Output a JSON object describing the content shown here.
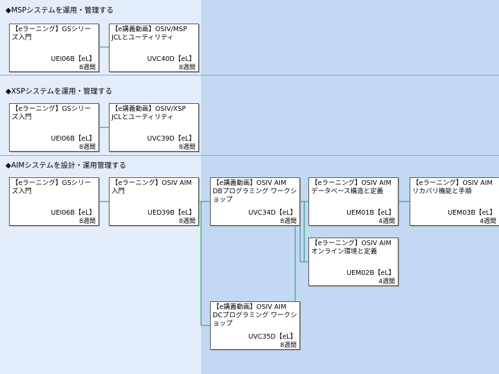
{
  "sections": [
    {
      "heading": "◆MSPシステムを運用・管理する",
      "cards": [
        {
          "title": "【eラーニング】GSシリーズ入門",
          "code": "UEI06B【eL】",
          "duration": "8週間"
        },
        {
          "title": "【e講義動画】OSIV/MSP JCLとユーティリティ",
          "code": "UVC40D【eL】",
          "duration": "8週間"
        }
      ]
    },
    {
      "heading": "◆XSPシステムを運用・管理する",
      "cards": [
        {
          "title": "【eラーニング】GSシリーズ入門",
          "code": "UEI06B【eL】",
          "duration": "8週間"
        },
        {
          "title": "【e講義動画】OSIV/XSP JCLとユーティリティ",
          "code": "UVC39D【eL】",
          "duration": "8週間"
        }
      ]
    },
    {
      "heading": "◆AIMシステムを設計・運用管理する",
      "cards": [
        {
          "title": "【eラーニング】GSシリーズ入門",
          "code": "UEI06B【eL】",
          "duration": "8週間"
        },
        {
          "title": "【eラーニング】OSIV AIM入門",
          "code": "UED39B【eL】",
          "duration": "8週間"
        },
        {
          "title": "【e講義動画】OSIV AIM DBプログラミング ワークショップ",
          "code": "UVC34D【eL】",
          "duration": "8週間"
        },
        {
          "title": "【eラーニング】OSIV AIMデータベース構造と定義",
          "code": "UEM01B【eL】",
          "duration": "4週間"
        },
        {
          "title": "【eラーニング】OSIV AIMリカバリ機能と手順",
          "code": "UEM03B【eL】",
          "duration": "4週間"
        },
        {
          "title": "【eラーニング】OSIV AIMオンライン環境と定義",
          "code": "UEM02B【eL】",
          "duration": "4週間"
        },
        {
          "title": "【e講義動画】OSIV AIM DCプログラミング ワークショップ",
          "code": "UVC35D【eL】",
          "duration": "8週間"
        }
      ]
    }
  ],
  "colors": {
    "left_band": "#e4eefa",
    "right_band": "#c2d8f3",
    "connector": "#3a9e78",
    "card_border": "#555555"
  }
}
